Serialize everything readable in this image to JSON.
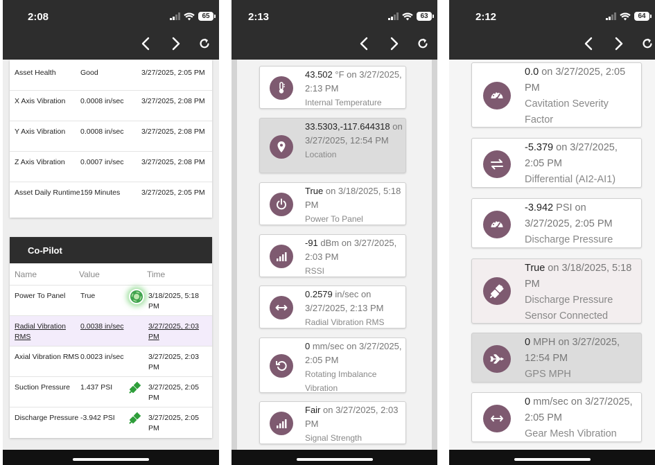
{
  "accent_color": "#7e5a70",
  "phone1": {
    "time": "2:08",
    "battery": "65",
    "asset_table": [
      {
        "name": "Asset Health",
        "value": "Good",
        "time": "3/27/2025, 2:05 PM"
      },
      {
        "name": "X Axis Vibration",
        "value": "0.0008 in/sec",
        "time": "3/27/2025, 2:08 PM"
      },
      {
        "name": "Y Axis Vibration",
        "value": "0.0008 in/sec",
        "time": "3/27/2025, 2:08 PM"
      },
      {
        "name": "Z Axis Vibration",
        "value": "0.0007 in/sec",
        "time": "3/27/2025, 2:08 PM"
      },
      {
        "name": "Asset Daily Runtime",
        "value": "159 Minutes",
        "time": "3/27/2025, 2:05 PM"
      }
    ],
    "copilot": {
      "title": "Co-Pilot",
      "headers": {
        "name": "Name",
        "value": "Value",
        "time": "Time"
      },
      "rows": [
        {
          "name": "Power To Panel",
          "value": "True",
          "icon": "lifebuoy-icon",
          "time": "3/18/2025, 5:18 PM"
        },
        {
          "name": "Radial Vibration RMS",
          "value": "0.0038 in/sec",
          "icon": "",
          "time": "3/27/2025, 2:03 PM"
        },
        {
          "name": "Axial Vibration RMS",
          "value": "0.0023 in/sec",
          "icon": "",
          "time": "3/27/2025, 2:03 PM"
        },
        {
          "name": "Suction Pressure",
          "value": "1.437 PSI",
          "icon": "plug-icon",
          "time": "3/27/2025, 2:05 PM"
        },
        {
          "name": "Discharge Pressure",
          "value": "-3.942 PSI",
          "icon": "plug-icon",
          "time": "3/27/2025, 2:05 PM"
        }
      ]
    }
  },
  "phone2": {
    "time": "2:13",
    "battery": "63",
    "cards": [
      {
        "icon": "thermometer-icon",
        "value": "43.502",
        "unit": " °F",
        "rest": " on 3/27/2025, 2:13 PM",
        "label": "Internal Temperature"
      },
      {
        "icon": "location-pin-icon",
        "value": "33.5303,-117.644318",
        "unit": "",
        "rest": " on 3/27/2025, 12:54 PM",
        "label": "Location"
      },
      {
        "icon": "power-icon",
        "value": "True",
        "unit": "",
        "rest": " on 3/18/2025, 5:18 PM",
        "label": "Power To Panel"
      },
      {
        "icon": "signal-bars-icon",
        "value": "-91",
        "unit": " dBm",
        "rest": " on 3/27/2025, 2:03 PM",
        "label": "RSSI"
      },
      {
        "icon": "double-arrow-icon",
        "value": "0.2579",
        "unit": " in/sec",
        "rest": " on 3/27/2025, 2:13 PM",
        "label": "Radial Vibration RMS"
      },
      {
        "icon": "rotate-icon",
        "value": "0",
        "unit": " mm/sec",
        "rest": " on 3/27/2025, 2:05 PM",
        "label": "Rotating Imbalance Vibration"
      },
      {
        "icon": "signal-bars-icon",
        "value": "Fair",
        "unit": "",
        "rest": " on 3/27/2025, 2:03 PM",
        "label": "Signal Strength"
      }
    ]
  },
  "phone3": {
    "time": "2:12",
    "battery": "64",
    "cards": [
      {
        "icon": "gauge-icon",
        "value": "0.0",
        "unit": "",
        "rest": " on 3/27/2025, 2:05 PM",
        "label": "Cavitation Severity Factor"
      },
      {
        "icon": "swap-arrows-icon",
        "value": "-5.379",
        "unit": "",
        "rest": " on 3/27/2025, 2:05 PM",
        "label": "Differential (AI2-AI1)"
      },
      {
        "icon": "gauge-icon",
        "value": "-3.942",
        "unit": " PSI",
        "rest": " on 3/27/2025, 2:05 PM",
        "label": "Discharge Pressure"
      },
      {
        "icon": "plug-icon",
        "value": "True",
        "unit": "",
        "rest": " on 3/18/2025, 5:18 PM",
        "label": "Discharge Pressure Sensor Connected"
      },
      {
        "icon": "airplane-icon",
        "value": "0",
        "unit": " MPH",
        "rest": " on 3/27/2025, 12:54 PM",
        "label": "GPS MPH"
      },
      {
        "icon": "double-arrow-icon",
        "value": "0",
        "unit": " mm/sec",
        "rest": " on 3/27/2025, 2:05 PM",
        "label": "Gear Mesh Vibration"
      }
    ]
  }
}
